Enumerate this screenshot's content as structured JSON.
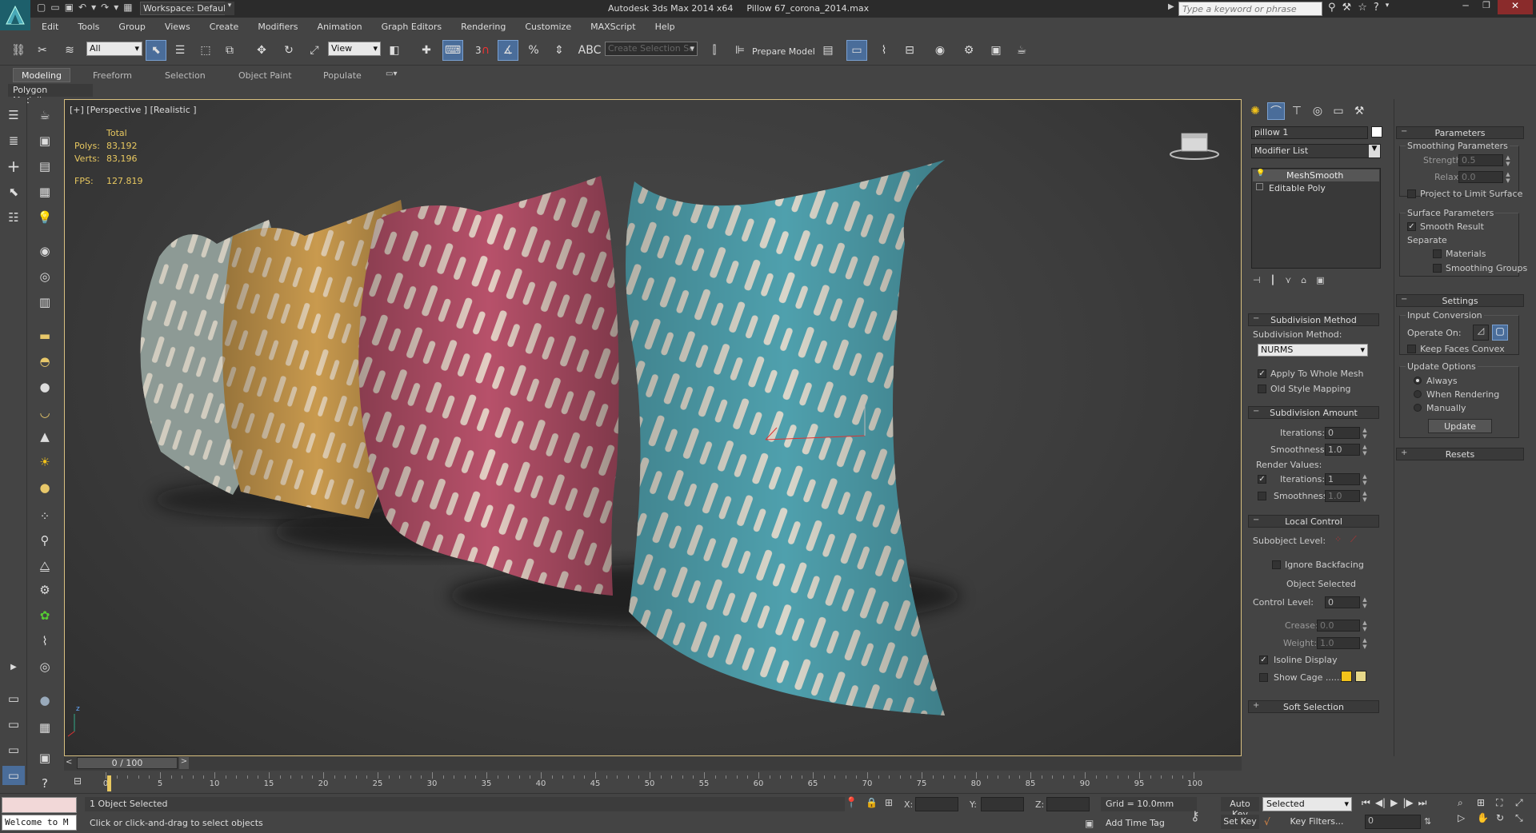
{
  "titlebar": {
    "workspace": "Workspace: Default",
    "app_title": "Autodesk 3ds Max  2014 x64",
    "file_title": "Pillow 67_corona_2014.max",
    "search_placeholder": "Type a keyword or phrase"
  },
  "menu": [
    "Edit",
    "Tools",
    "Group",
    "Views",
    "Create",
    "Modifiers",
    "Animation",
    "Graph Editors",
    "Rendering",
    "Customize",
    "MAXScript",
    "Help"
  ],
  "toolbar": {
    "filter_value": "All",
    "refcoord_value": "View",
    "snap_label": "3",
    "selection_set_placeholder": "Create Selection Se",
    "prepare_model": "Prepare Model"
  },
  "ribbon": {
    "tabs": [
      "Modeling",
      "Freeform",
      "Selection",
      "Object Paint",
      "Populate"
    ],
    "active_tab": "Modeling",
    "subtitle": "Polygon Modeling"
  },
  "viewport": {
    "label": "[+] [Perspective ] [Realistic ]",
    "stats": {
      "header": "Total",
      "polys_label": "Polys:",
      "polys_value": "83,192",
      "verts_label": "Verts:",
      "verts_value": "83,196",
      "fps_label": "FPS:",
      "fps_value": "127.819"
    },
    "colors": {
      "pillow_grey": "#8d9a95",
      "pillow_yellow": "#c99a4e",
      "pillow_pink": "#b7516a",
      "pillow_teal": "#4fa0ad",
      "pattern": "#e8dccd",
      "frame": "#d8c080"
    }
  },
  "command_panel": {
    "object_name": "pillow 1",
    "modifier_list_label": "Modifier List",
    "stack": [
      {
        "name": "MeshSmooth",
        "selected": true
      },
      {
        "name": "Editable Poly",
        "selected": false
      }
    ],
    "subdivision_method": {
      "title": "Subdivision Method",
      "method_label": "Subdivision Method:",
      "method_value": "NURMS",
      "apply_whole_mesh": "Apply To Whole Mesh",
      "apply_whole_mesh_checked": true,
      "old_style_mapping": "Old Style Mapping",
      "old_style_mapping_checked": false
    },
    "subdivision_amount": {
      "title": "Subdivision Amount",
      "iterations_label": "Iterations:",
      "iterations_value": "0",
      "smoothness_label": "Smoothness:",
      "smoothness_value": "1.0",
      "render_values_label": "Render Values:",
      "render_iterations_label": "Iterations:",
      "render_iterations_value": "1",
      "render_iterations_checked": true,
      "render_smoothness_label": "Smoothness:",
      "render_smoothness_value": "1.0",
      "render_smoothness_checked": false
    },
    "local_control": {
      "title": "Local Control",
      "subobject_label": "Subobject Level:",
      "ignore_backfacing": "Ignore Backfacing",
      "object_selected": "Object Selected",
      "control_level_label": "Control Level:",
      "control_level_value": "0",
      "crease_label": "Crease:",
      "crease_value": "0.0",
      "weight_label": "Weight:",
      "weight_value": "1.0",
      "isoline_display": "Isoline Display",
      "isoline_checked": true,
      "show_cage": "Show Cage ......",
      "cage_color_1": "#f2c21a",
      "cage_color_2": "#e6d88a"
    },
    "soft_selection": "Soft Selection"
  },
  "parameters_panel": {
    "title": "Parameters",
    "smoothing_params_label": "Smoothing Parameters",
    "strength_label": "Strength:",
    "strength_value": "0.5",
    "relax_label": "Relax:",
    "relax_value": "0.0",
    "project_limit": "Project to Limit Surface",
    "surface_params_label": "Surface Parameters",
    "smooth_result": "Smooth Result",
    "separate_label": "Separate",
    "materials": "Materials",
    "smoothing_groups": "Smoothing Groups",
    "settings_title": "Settings",
    "input_conversion": "Input Conversion",
    "operate_on": "Operate On:",
    "keep_faces_convex": "Keep Faces Convex",
    "update_options": "Update Options",
    "always": "Always",
    "when_rendering": "When Rendering",
    "manually": "Manually",
    "update_button": "Update",
    "resets_title": "Resets"
  },
  "timeline": {
    "frame_display": "0 / 100",
    "ticks": [
      "0",
      "5",
      "10",
      "15",
      "20",
      "25",
      "30",
      "35",
      "40",
      "45",
      "50",
      "55",
      "60",
      "65",
      "70",
      "75",
      "80",
      "85",
      "90",
      "95",
      "100"
    ]
  },
  "statusbar": {
    "maxscript": "Welcome to M",
    "selection_status": "1 Object Selected",
    "prompt": "Click or click-and-drag to select objects",
    "x_label": "X:",
    "y_label": "Y:",
    "z_label": "Z:",
    "grid": "Grid = 10.0mm",
    "add_time_tag": "Add Time Tag",
    "auto_key": "Auto Key",
    "set_key": "Set Key",
    "key_mode_value": "Selected",
    "key_filters": "Key Filters...",
    "current_frame": "0"
  }
}
